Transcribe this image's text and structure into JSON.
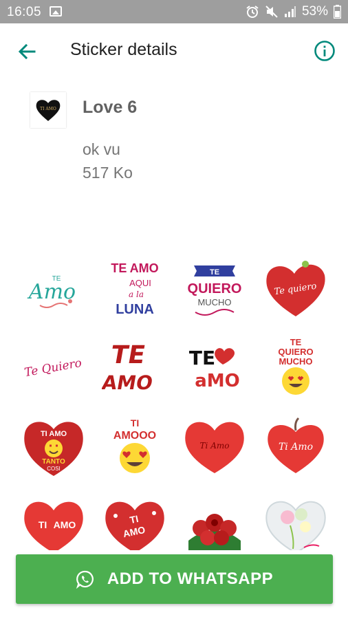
{
  "status_bar": {
    "time": "16:05",
    "battery": "53%"
  },
  "app_bar": {
    "title": "Sticker details"
  },
  "pack": {
    "tray_text": "TI AMO",
    "name": "Love 6",
    "publisher": "ok vu",
    "size": "517 Ko"
  },
  "stickers": [
    {
      "name": "te-amo-script",
      "text": "Amo"
    },
    {
      "name": "te-amo-aqui-luna",
      "text": "TE AMO"
    },
    {
      "name": "te-quiero-mucho-banner",
      "text": "QUIERO"
    },
    {
      "name": "te-quiero-red-heart",
      "text": "Te quiero"
    },
    {
      "name": "te-quiero-script",
      "text": "Te Quiero"
    },
    {
      "name": "te-amo-brush",
      "text": "TE"
    },
    {
      "name": "te-amo-heart-black",
      "text": "TE"
    },
    {
      "name": "te-quiero-mucho-emoji",
      "text": "TE"
    },
    {
      "name": "ti-amo-tanto-heart",
      "text": "TI AMO"
    },
    {
      "name": "ti-amooo-emoji",
      "text": "TI"
    },
    {
      "name": "ti-amo-plush-heart",
      "text": "Ti Amo"
    },
    {
      "name": "ti-amo-apple-heart",
      "text": "Ti Amo"
    },
    {
      "name": "ti-amo-glossy-heart",
      "text": "TI"
    },
    {
      "name": "ti-amo-hearts-bubble",
      "text": "TI"
    },
    {
      "name": "red-roses",
      "text": ""
    },
    {
      "name": "flowers-heart",
      "text": ""
    }
  ],
  "add_button": {
    "label": "ADD TO WHATSAPP"
  },
  "colors": {
    "accent": "#00897b",
    "button": "#4caf50",
    "status_bar": "#9e9e9e"
  }
}
